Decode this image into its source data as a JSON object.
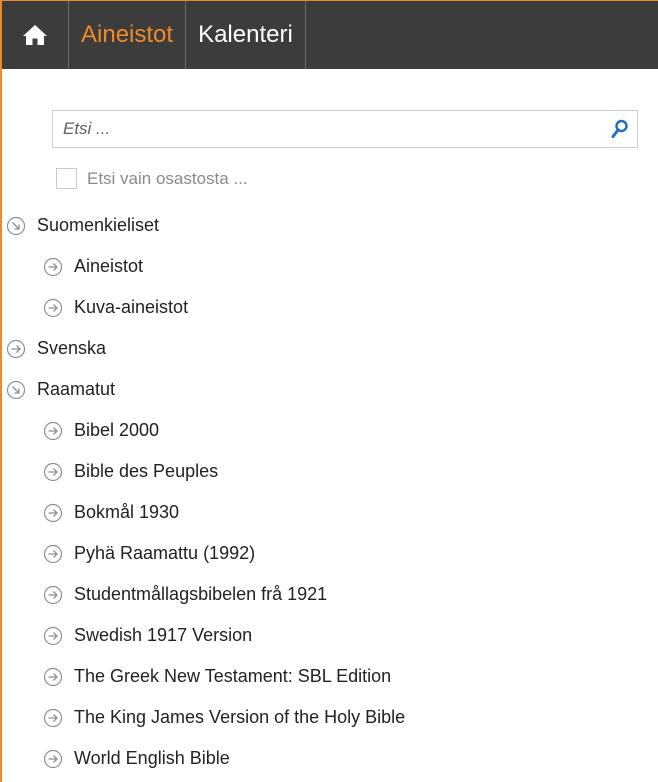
{
  "nav": {
    "home_icon": "home-icon",
    "tabs": [
      {
        "label": "Aineistot",
        "active": true
      },
      {
        "label": "Kalenteri",
        "active": false
      }
    ]
  },
  "search": {
    "placeholder": "Etsi ...",
    "value": "",
    "icon": "search-icon"
  },
  "filter": {
    "label": "Etsi vain osastosta ...",
    "checked": false
  },
  "tree": [
    {
      "label": "Suomenkieliset",
      "level": 0,
      "expanded": true
    },
    {
      "label": "Aineistot",
      "level": 1,
      "expanded": false
    },
    {
      "label": "Kuva-aineistot",
      "level": 1,
      "expanded": false
    },
    {
      "label": "Svenska",
      "level": 0,
      "expanded": false
    },
    {
      "label": "Raamatut",
      "level": 0,
      "expanded": true
    },
    {
      "label": "Bibel 2000",
      "level": 1,
      "expanded": false
    },
    {
      "label": "Bible des Peuples",
      "level": 1,
      "expanded": false
    },
    {
      "label": "Bokmål 1930",
      "level": 1,
      "expanded": false
    },
    {
      "label": "Pyhä Raamattu (1992)",
      "level": 1,
      "expanded": false
    },
    {
      "label": "Studentmållagsbibelen frå 1921",
      "level": 1,
      "expanded": false
    },
    {
      "label": "Swedish 1917 Version",
      "level": 1,
      "expanded": false
    },
    {
      "label": "The Greek New Testament: SBL Edition",
      "level": 1,
      "expanded": false
    },
    {
      "label": "The King James Version of the Holy Bible",
      "level": 1,
      "expanded": false
    },
    {
      "label": "World English Bible",
      "level": 1,
      "expanded": false
    }
  ],
  "colors": {
    "accent": "#ef8a2c",
    "topbar": "#3c3c3c",
    "search_icon": "#1e6fbf",
    "tree_icon": "#8f8f8f"
  }
}
